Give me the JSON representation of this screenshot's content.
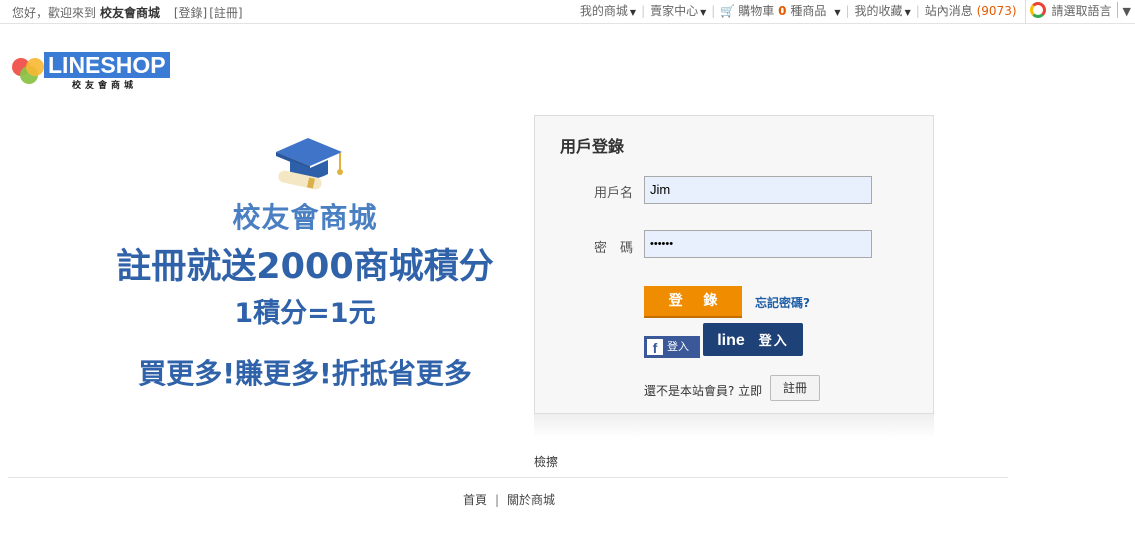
{
  "topbar": {
    "greeting": "您好，歡迎來到",
    "shop_name": "校友會商城",
    "login_link": "[登錄]",
    "register_link": "[註冊]",
    "my_shop": "我的商城",
    "seller_center": "賣家中心",
    "cart_label": "購物車",
    "cart_count": "0",
    "cart_unit": "種商品",
    "favorites": "我的收藏",
    "messages_label": "站內消息",
    "messages_count": "(9073)",
    "language": "請選取語言"
  },
  "logo": {
    "text": "LINESHOP",
    "subtitle": "校友會商城"
  },
  "promo": {
    "title": "校友會商城",
    "headline": "註冊就送2000商城積分",
    "rate": "1積分=1元",
    "slogan": "買更多!賺更多!折抵省更多"
  },
  "login": {
    "title": "用戶登錄",
    "username_label": "用戶名",
    "username_value": "Jim",
    "password_label": "密　碼",
    "password_value": "••••••",
    "submit_label": "登 錄",
    "forgot_label": "忘記密碼?",
    "facebook_label": "登入",
    "line_label": "line",
    "line_login": "登入",
    "not_member": "還不是本站會員? 立即",
    "register_button": "註冊"
  },
  "note": "檢擦",
  "footer": {
    "home": "首頁",
    "separator": "|",
    "about": "關於商城"
  },
  "colors": {
    "accent_orange": "#f08c00",
    "brand_blue": "#2f62a8",
    "facebook_blue": "#3b5998",
    "line_navy": "#1e4177"
  }
}
